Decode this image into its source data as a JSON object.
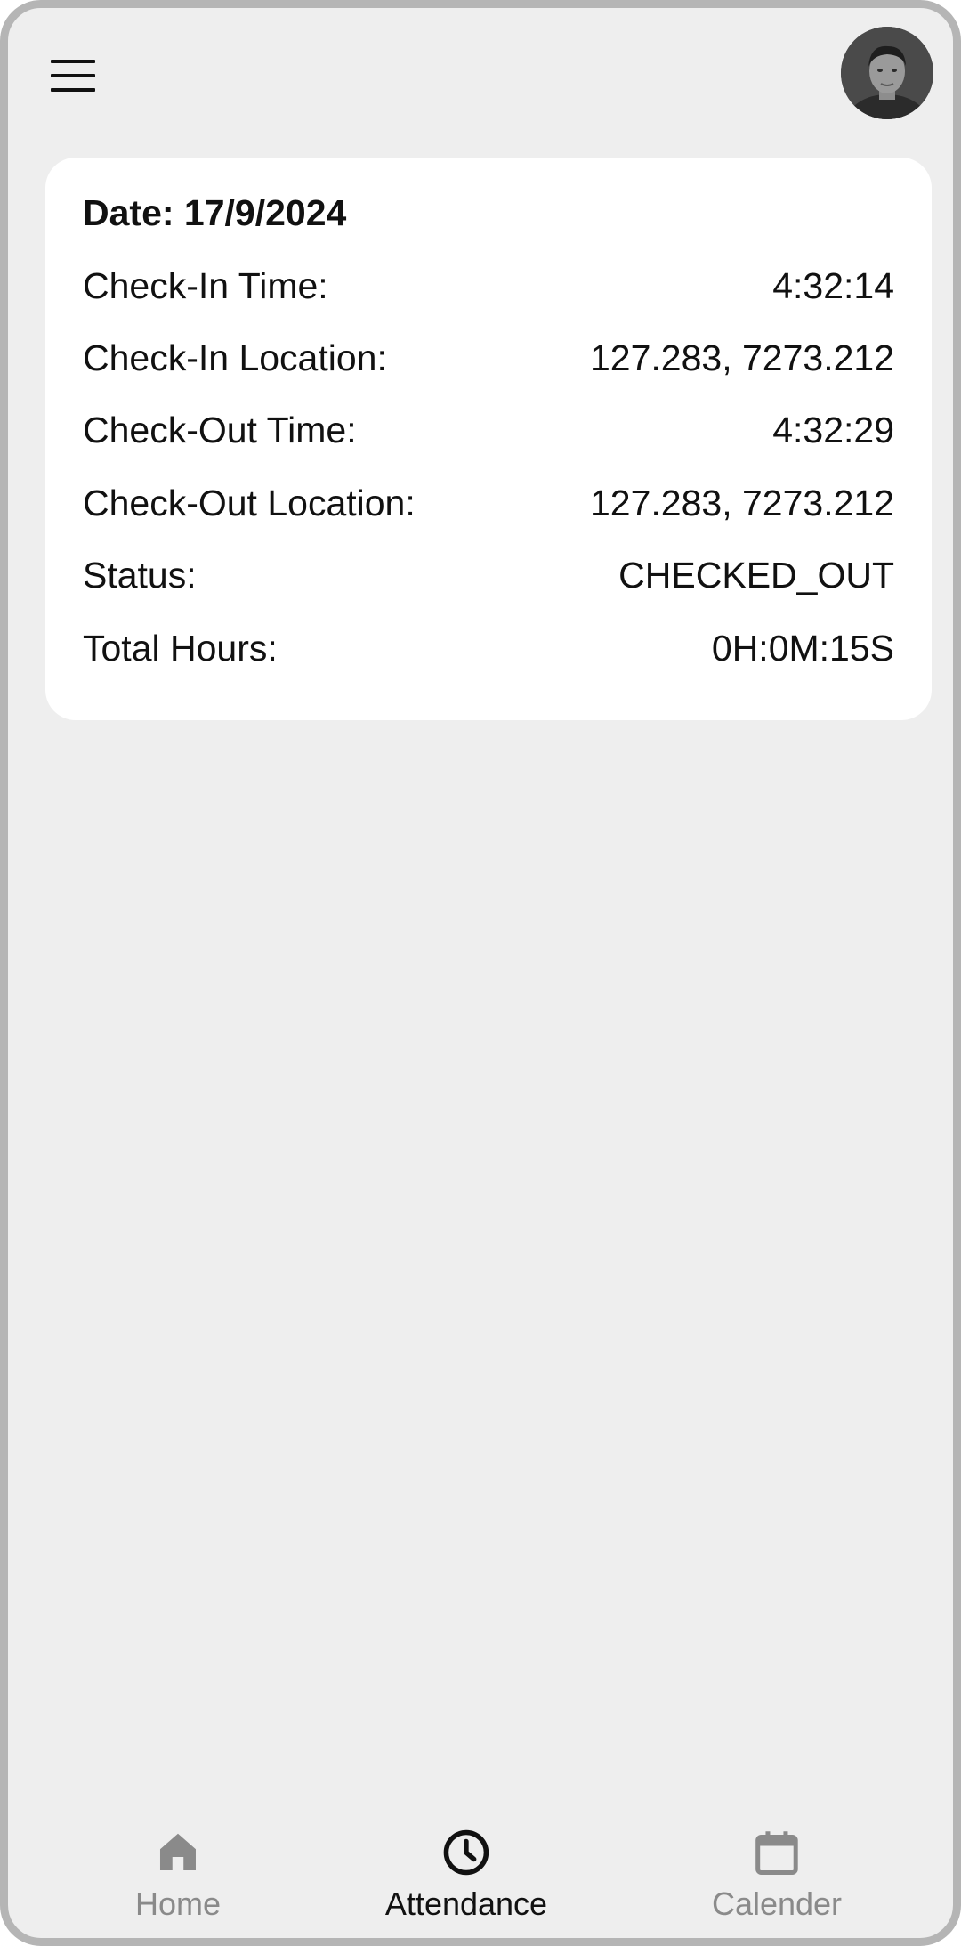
{
  "header": {
    "menu_icon": "hamburger-menu-icon",
    "avatar_icon": "profile-avatar"
  },
  "attendance_card": {
    "date_label": "Date: 17/9/2024",
    "rows": [
      {
        "label": "Check-In Time:",
        "value": "4:32:14"
      },
      {
        "label": "Check-In Location:",
        "value": "127.283, 7273.212"
      },
      {
        "label": "Check-Out Time:",
        "value": "4:32:29"
      },
      {
        "label": "Check-Out Location:",
        "value": "127.283, 7273.212"
      },
      {
        "label": "Status:",
        "value": "CHECKED_OUT"
      },
      {
        "label": "Total Hours:",
        "value": "0H:0M:15S"
      }
    ]
  },
  "bottom_nav": {
    "items": [
      {
        "label": "Home",
        "icon": "home-icon",
        "active": false
      },
      {
        "label": "Attendance",
        "icon": "clock-icon",
        "active": true
      },
      {
        "label": "Calender",
        "icon": "calendar-icon",
        "active": false
      }
    ]
  },
  "colors": {
    "background": "#eeeeee",
    "card": "#ffffff",
    "text": "#111111",
    "inactive": "#8a8a8a",
    "frame": "#b5b5b5"
  }
}
